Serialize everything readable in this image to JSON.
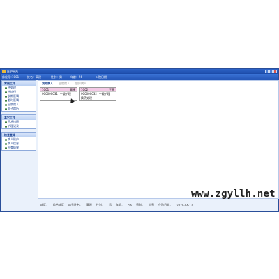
{
  "window": {
    "title": "医护平台"
  },
  "infobar": {
    "bed_no_label": "床位号：",
    "bed_no": "1001",
    "name_label": "姓名：",
    "name": "高建",
    "gender_label": "性别：",
    "gender": "男",
    "age_label": "年龄：",
    "age": "56",
    "admit_date": "入院日期"
  },
  "sidebar": {
    "groups": [
      {
        "title": "常规工作",
        "items": [
          "待处理",
          "待执行",
          "长期医嘱",
          "临时医嘱",
          "出院病人",
          "电子病历"
        ]
      },
      {
        "title": "其它工作",
        "items": [
          "手术排班",
          "护理记录"
        ]
      },
      {
        "title": "检查查询",
        "items": [
          "病人账户",
          "病人信息",
          "检查结果"
        ]
      }
    ]
  },
  "tabs": [
    {
      "label": "我的病人",
      "active": true
    },
    {
      "label": "全院病人",
      "active": false
    },
    {
      "label": "空床病人",
      "active": false
    }
  ],
  "cards": [
    {
      "bed": "1001",
      "name": "高建",
      "id": "000000031",
      "status": "一级护理",
      "extra": ""
    },
    {
      "bed": "1002",
      "name": "王亮",
      "id": "000000032",
      "status": "一级护理",
      "extra": "换药处理"
    }
  ],
  "statusbar": [
    "病区：",
    "综合病区",
    "病号姓名：",
    "高建",
    "性别：",
    "男",
    "年龄：",
    "56",
    "费别：",
    "自费",
    "住院日期：",
    "2020-04-12"
  ],
  "watermark": "www.zgyllh.net",
  "colors": {
    "titlebar": "#1b4aa8",
    "card_header": "#f4c9e6",
    "panel_head": "#b9cff2"
  }
}
